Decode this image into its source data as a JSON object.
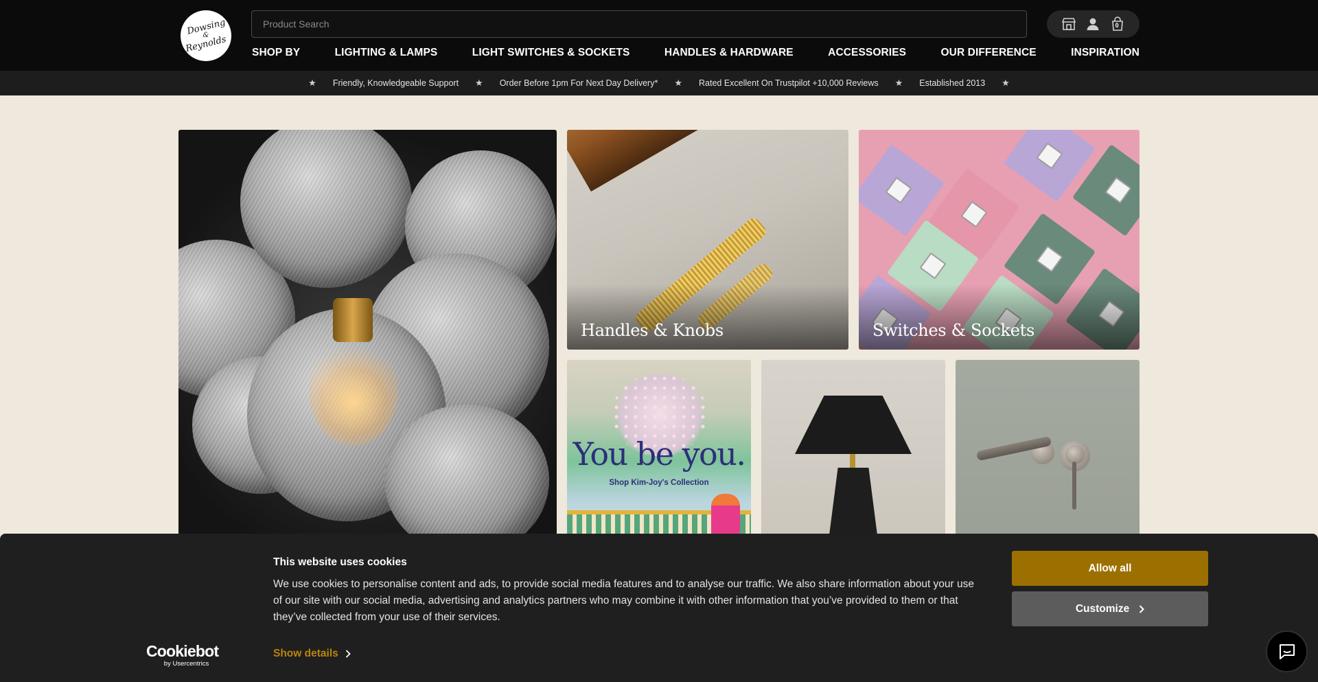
{
  "brand": {
    "logo_line1": "Dowsing",
    "logo_amp": "&",
    "logo_line2": "Reynolds"
  },
  "header": {
    "search_placeholder": "Product Search",
    "basket_count": "0",
    "icons": [
      "store-icon",
      "account-icon",
      "basket-icon"
    ]
  },
  "nav": {
    "items": [
      {
        "label": "SHOP BY"
      },
      {
        "label": "LIGHTING & LAMPS"
      },
      {
        "label": "LIGHT SWITCHES & SOCKETS"
      },
      {
        "label": "HANDLES & HARDWARE"
      },
      {
        "label": "ACCESSORIES"
      },
      {
        "label": "OUR DIFFERENCE"
      },
      {
        "label": "INSPIRATION"
      }
    ]
  },
  "usp": {
    "star": "★",
    "items": [
      "Friendly, Knowledgeable Support",
      "Order Before 1pm For Next Day Delivery*",
      "Rated Excellent On Trustpilot +10,000 Reviews",
      "Established 2013"
    ]
  },
  "tiles": {
    "handles": {
      "label": "Handles & Knobs"
    },
    "switches": {
      "label": "Switches & Sockets"
    },
    "kimjoy": {
      "title": "You be you.",
      "subtitle": "Shop Kim-Joy's Collection"
    }
  },
  "cookie": {
    "title": "This website uses cookies",
    "body": "We use cookies to personalise content and ads, to provide social media features and to analyse our traffic. We also share information about your use of our site with our social media, advertising and analytics partners who may combine it with other information that you’ve provided to them or that they’ve collected from your use of their services.",
    "brand": "Cookiebot",
    "brand_sub": "by Usercentrics",
    "show_details": "Show details",
    "allow_all": "Allow all",
    "customize": "Customize"
  },
  "colors": {
    "header_bg": "#0b0b0b",
    "page_bg": "#efe8dc",
    "allow_btn": "#9c7000",
    "customize_btn": "#5c5c5c",
    "show_details": "#b8860b"
  }
}
